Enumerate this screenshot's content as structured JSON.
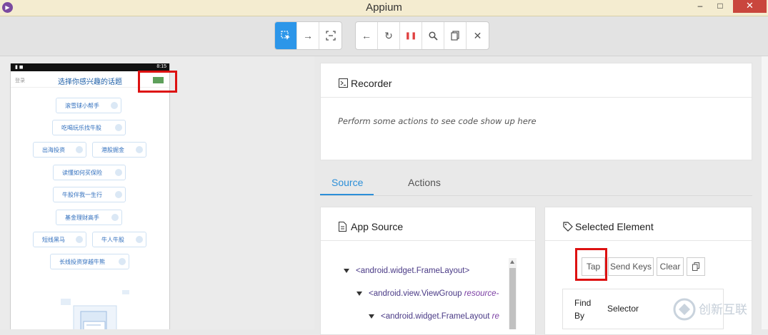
{
  "window": {
    "title": "Appium",
    "min": "–",
    "max": "□",
    "close": "✕"
  },
  "toolbar": {
    "mode_buttons": [
      {
        "name": "select-element-icon",
        "glyph": "⬚",
        "active": true
      },
      {
        "name": "swipe-icon",
        "glyph": "→"
      },
      {
        "name": "tap-by-coordinates-icon",
        "glyph": "⛶"
      }
    ],
    "action_buttons": [
      {
        "name": "back-icon",
        "glyph": "←"
      },
      {
        "name": "refresh-icon",
        "glyph": "↻"
      },
      {
        "name": "pause-icon",
        "glyph": "❚❚"
      },
      {
        "name": "search-icon",
        "glyph": "⚲"
      },
      {
        "name": "copy-xml-icon",
        "glyph": "❐"
      },
      {
        "name": "close-icon",
        "glyph": "✕"
      }
    ]
  },
  "phone": {
    "status_time": "8:15",
    "login": "登录",
    "header_title": "选择你感兴趣的话题",
    "topics": [
      "滚雪球小帮手",
      "吃喝玩乐找牛股",
      "出海投资",
      "港股掘金",
      "读懂如何买保险",
      "牛股伴我一生行",
      "基金理财高手",
      "短线黑马",
      "牛人牛股",
      "长线投资穿越牛熊"
    ]
  },
  "recorder": {
    "title": "Recorder",
    "hint": "Perform some actions to see code show up here"
  },
  "tabs": [
    "Source",
    "Actions"
  ],
  "app_source": {
    "title": "App Source",
    "tree": [
      {
        "tag": "<android.widget.FrameLayout>",
        "attr": ""
      },
      {
        "tag": "<android.view.ViewGroup ",
        "attr": "resource-"
      },
      {
        "tag": "<android.widget.FrameLayout ",
        "attr": "re"
      }
    ]
  },
  "selected_element": {
    "title": "Selected Element",
    "buttons": [
      "Tap",
      "Send Keys",
      "Clear"
    ],
    "columns": [
      "Find By",
      "Selector"
    ]
  },
  "watermark": "创新互联"
}
